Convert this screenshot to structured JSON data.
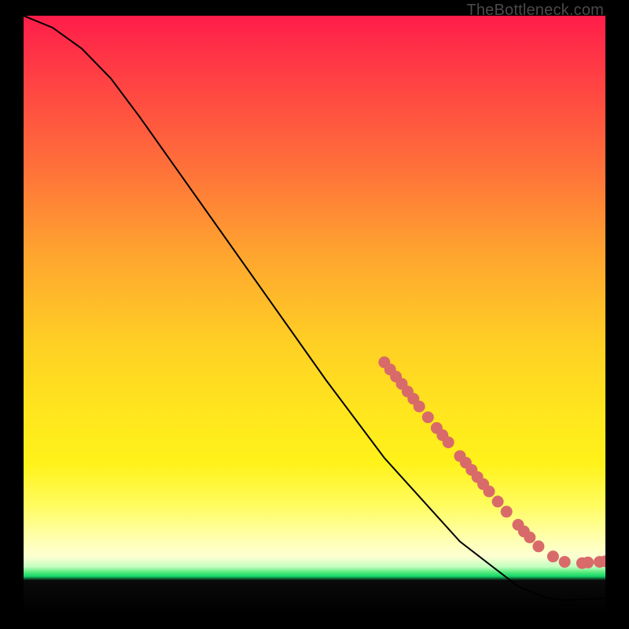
{
  "watermark": "TheBottleneck.com",
  "colors": {
    "curve_stroke": "#000000",
    "marker_fill": "#d96a6a",
    "marker_stroke": "#d96a6a"
  },
  "chart_data": {
    "type": "line",
    "title": "",
    "xlabel": "",
    "ylabel": "",
    "xlim": [
      0,
      100
    ],
    "ylim": [
      0,
      100
    ],
    "curve": [
      {
        "x": 0,
        "y": 100
      },
      {
        "x": 5,
        "y": 98
      },
      {
        "x": 10,
        "y": 94.5
      },
      {
        "x": 15,
        "y": 89.5
      },
      {
        "x": 20,
        "y": 83
      },
      {
        "x": 28,
        "y": 72
      },
      {
        "x": 40,
        "y": 55.5
      },
      {
        "x": 52,
        "y": 39
      },
      {
        "x": 62,
        "y": 26
      },
      {
        "x": 75,
        "y": 12
      },
      {
        "x": 85,
        "y": 4.5
      },
      {
        "x": 90,
        "y": 2.5
      },
      {
        "x": 93,
        "y": 2.2
      },
      {
        "x": 96,
        "y": 2.3
      },
      {
        "x": 100,
        "y": 2.5
      }
    ],
    "markers": [
      {
        "x": 62,
        "y": 42
      },
      {
        "x": 63,
        "y": 40.8
      },
      {
        "x": 64,
        "y": 39.6
      },
      {
        "x": 65,
        "y": 38.4
      },
      {
        "x": 66,
        "y": 37.1
      },
      {
        "x": 67,
        "y": 35.9
      },
      {
        "x": 68,
        "y": 34.6
      },
      {
        "x": 69.5,
        "y": 32.8
      },
      {
        "x": 71,
        "y": 31
      },
      {
        "x": 72,
        "y": 29.8
      },
      {
        "x": 73,
        "y": 28.6
      },
      {
        "x": 75,
        "y": 26.3
      },
      {
        "x": 76,
        "y": 25.2
      },
      {
        "x": 77,
        "y": 24
      },
      {
        "x": 78,
        "y": 22.8
      },
      {
        "x": 79,
        "y": 21.6
      },
      {
        "x": 80,
        "y": 20.4
      },
      {
        "x": 81.5,
        "y": 18.7
      },
      {
        "x": 83,
        "y": 17
      },
      {
        "x": 85,
        "y": 14.8
      },
      {
        "x": 86,
        "y": 13.7
      },
      {
        "x": 87,
        "y": 12.7
      },
      {
        "x": 88.5,
        "y": 11.2
      },
      {
        "x": 91,
        "y": 9.5
      },
      {
        "x": 93,
        "y": 8.6
      },
      {
        "x": 96,
        "y": 8.4
      },
      {
        "x": 97,
        "y": 8.5
      },
      {
        "x": 99,
        "y": 8.6
      },
      {
        "x": 100,
        "y": 8.7
      }
    ]
  }
}
